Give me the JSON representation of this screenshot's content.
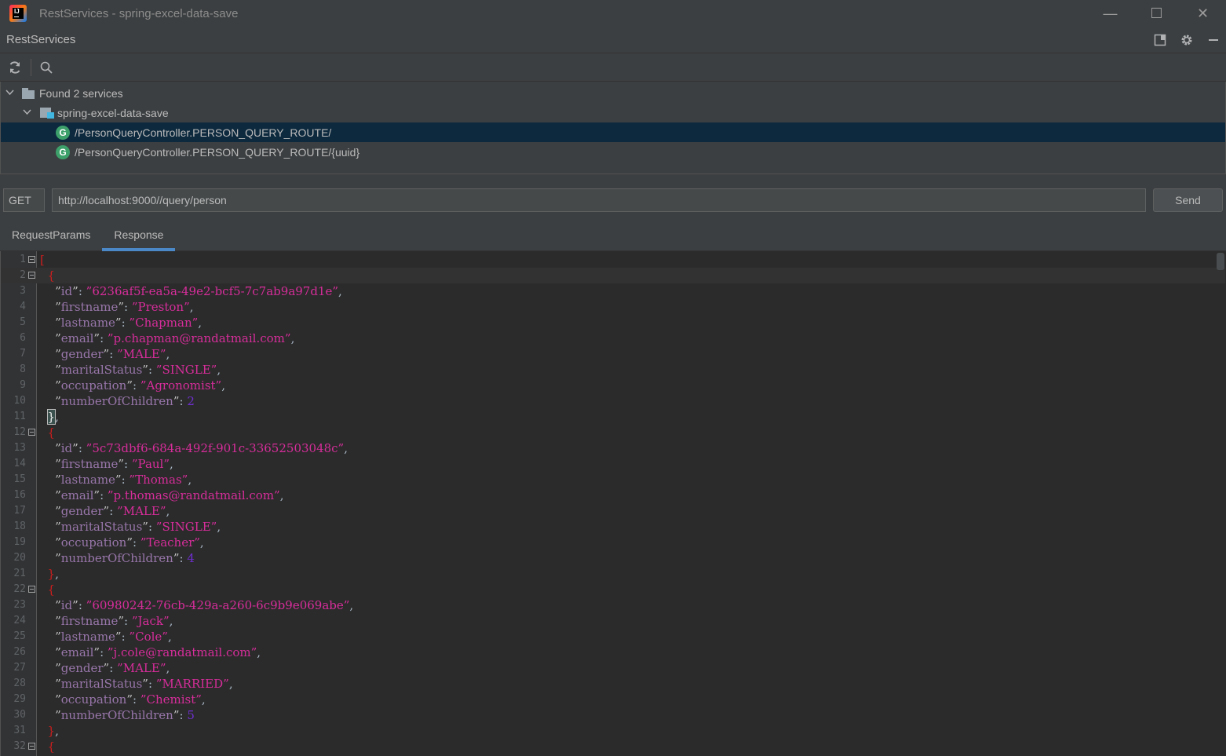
{
  "window": {
    "title": "RestServices - spring-excel-data-save",
    "controls": {
      "minimize": "—",
      "maximize": "☐",
      "close": "✕"
    }
  },
  "tool_window": {
    "title": "RestServices",
    "actions": [
      "layout-icon",
      "gear-icon",
      "minimize-icon"
    ]
  },
  "toolbar": {
    "refresh_icon": "refresh-icon",
    "search_icon": "search-icon"
  },
  "tree": {
    "root": {
      "label": "Found 2 services",
      "expanded": true
    },
    "module": {
      "label": "spring-excel-data-save",
      "expanded": true
    },
    "endpoints": [
      {
        "badge": "G",
        "label": "/PersonQueryController.PERSON_QUERY_ROUTE/",
        "selected": true
      },
      {
        "badge": "G",
        "label": "/PersonQueryController.PERSON_QUERY_ROUTE/{uuid}",
        "selected": false
      }
    ]
  },
  "request": {
    "method": "GET",
    "url": "http://localhost:9000//query/person",
    "send_label": "Send"
  },
  "tabs": [
    {
      "label": "RequestParams",
      "active": false
    },
    {
      "label": "Response",
      "active": true
    }
  ],
  "response": {
    "records": [
      {
        "id": "6236af5f-ea5a-49e2-bcf5-7c7ab9a97d1e",
        "firstname": "Preston",
        "lastname": "Chapman",
        "email": "p.chapman@randatmail.com",
        "gender": "MALE",
        "maritalStatus": "SINGLE",
        "occupation": "Agronomist",
        "numberOfChildren": "2"
      },
      {
        "id": "5c73dbf6-684a-492f-901c-33652503048c",
        "firstname": "Paul",
        "lastname": "Thomas",
        "email": "p.thomas@randatmail.com",
        "gender": "MALE",
        "maritalStatus": "SINGLE",
        "occupation": "Teacher",
        "numberOfChildren": "4"
      },
      {
        "id": "60980242-76cb-429a-a260-6c9b9e069abe",
        "firstname": "Jack",
        "lastname": "Cole",
        "email": "j.cole@randatmail.com",
        "gender": "MALE",
        "maritalStatus": "MARRIED",
        "occupation": "Chemist",
        "numberOfChildren": "5"
      }
    ],
    "current_line": 2,
    "caret_line": 11
  },
  "colors": {
    "bracket": "#cc1e1e",
    "string": "#d62d9a",
    "number": "#6f2fd0",
    "selection": "#0d293e",
    "tab_underline": "#4a88c7"
  }
}
